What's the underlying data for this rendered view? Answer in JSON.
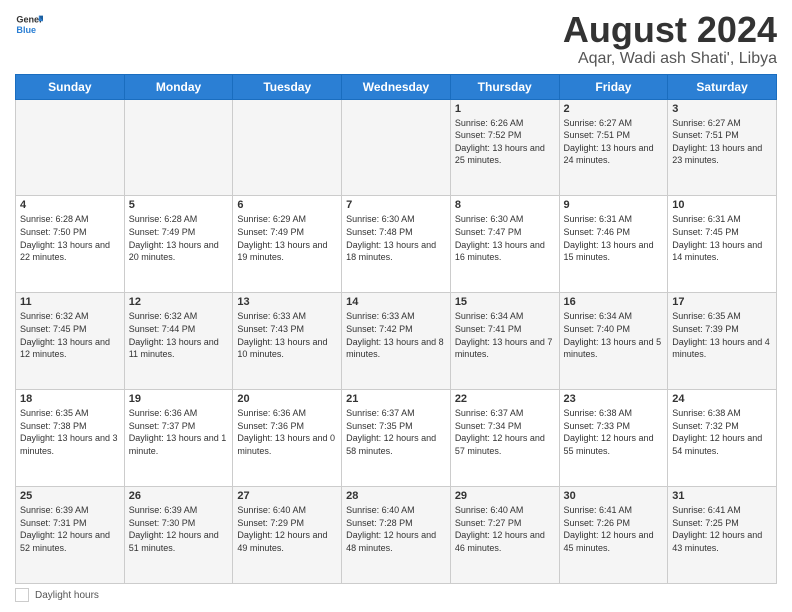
{
  "header": {
    "logo_line1": "General",
    "logo_line2": "Blue",
    "month": "August 2024",
    "location": "Aqar, Wadi ash Shati', Libya"
  },
  "weekdays": [
    "Sunday",
    "Monday",
    "Tuesday",
    "Wednesday",
    "Thursday",
    "Friday",
    "Saturday"
  ],
  "weeks": [
    [
      {
        "day": "",
        "info": ""
      },
      {
        "day": "",
        "info": ""
      },
      {
        "day": "",
        "info": ""
      },
      {
        "day": "",
        "info": ""
      },
      {
        "day": "1",
        "info": "Sunrise: 6:26 AM\nSunset: 7:52 PM\nDaylight: 13 hours\nand 25 minutes."
      },
      {
        "day": "2",
        "info": "Sunrise: 6:27 AM\nSunset: 7:51 PM\nDaylight: 13 hours\nand 24 minutes."
      },
      {
        "day": "3",
        "info": "Sunrise: 6:27 AM\nSunset: 7:51 PM\nDaylight: 13 hours\nand 23 minutes."
      }
    ],
    [
      {
        "day": "4",
        "info": "Sunrise: 6:28 AM\nSunset: 7:50 PM\nDaylight: 13 hours\nand 22 minutes."
      },
      {
        "day": "5",
        "info": "Sunrise: 6:28 AM\nSunset: 7:49 PM\nDaylight: 13 hours\nand 20 minutes."
      },
      {
        "day": "6",
        "info": "Sunrise: 6:29 AM\nSunset: 7:49 PM\nDaylight: 13 hours\nand 19 minutes."
      },
      {
        "day": "7",
        "info": "Sunrise: 6:30 AM\nSunset: 7:48 PM\nDaylight: 13 hours\nand 18 minutes."
      },
      {
        "day": "8",
        "info": "Sunrise: 6:30 AM\nSunset: 7:47 PM\nDaylight: 13 hours\nand 16 minutes."
      },
      {
        "day": "9",
        "info": "Sunrise: 6:31 AM\nSunset: 7:46 PM\nDaylight: 13 hours\nand 15 minutes."
      },
      {
        "day": "10",
        "info": "Sunrise: 6:31 AM\nSunset: 7:45 PM\nDaylight: 13 hours\nand 14 minutes."
      }
    ],
    [
      {
        "day": "11",
        "info": "Sunrise: 6:32 AM\nSunset: 7:45 PM\nDaylight: 13 hours\nand 12 minutes."
      },
      {
        "day": "12",
        "info": "Sunrise: 6:32 AM\nSunset: 7:44 PM\nDaylight: 13 hours\nand 11 minutes."
      },
      {
        "day": "13",
        "info": "Sunrise: 6:33 AM\nSunset: 7:43 PM\nDaylight: 13 hours\nand 10 minutes."
      },
      {
        "day": "14",
        "info": "Sunrise: 6:33 AM\nSunset: 7:42 PM\nDaylight: 13 hours\nand 8 minutes."
      },
      {
        "day": "15",
        "info": "Sunrise: 6:34 AM\nSunset: 7:41 PM\nDaylight: 13 hours\nand 7 minutes."
      },
      {
        "day": "16",
        "info": "Sunrise: 6:34 AM\nSunset: 7:40 PM\nDaylight: 13 hours\nand 5 minutes."
      },
      {
        "day": "17",
        "info": "Sunrise: 6:35 AM\nSunset: 7:39 PM\nDaylight: 13 hours\nand 4 minutes."
      }
    ],
    [
      {
        "day": "18",
        "info": "Sunrise: 6:35 AM\nSunset: 7:38 PM\nDaylight: 13 hours\nand 3 minutes."
      },
      {
        "day": "19",
        "info": "Sunrise: 6:36 AM\nSunset: 7:37 PM\nDaylight: 13 hours\nand 1 minute."
      },
      {
        "day": "20",
        "info": "Sunrise: 6:36 AM\nSunset: 7:36 PM\nDaylight: 13 hours\nand 0 minutes."
      },
      {
        "day": "21",
        "info": "Sunrise: 6:37 AM\nSunset: 7:35 PM\nDaylight: 12 hours\nand 58 minutes."
      },
      {
        "day": "22",
        "info": "Sunrise: 6:37 AM\nSunset: 7:34 PM\nDaylight: 12 hours\nand 57 minutes."
      },
      {
        "day": "23",
        "info": "Sunrise: 6:38 AM\nSunset: 7:33 PM\nDaylight: 12 hours\nand 55 minutes."
      },
      {
        "day": "24",
        "info": "Sunrise: 6:38 AM\nSunset: 7:32 PM\nDaylight: 12 hours\nand 54 minutes."
      }
    ],
    [
      {
        "day": "25",
        "info": "Sunrise: 6:39 AM\nSunset: 7:31 PM\nDaylight: 12 hours\nand 52 minutes."
      },
      {
        "day": "26",
        "info": "Sunrise: 6:39 AM\nSunset: 7:30 PM\nDaylight: 12 hours\nand 51 minutes."
      },
      {
        "day": "27",
        "info": "Sunrise: 6:40 AM\nSunset: 7:29 PM\nDaylight: 12 hours\nand 49 minutes."
      },
      {
        "day": "28",
        "info": "Sunrise: 6:40 AM\nSunset: 7:28 PM\nDaylight: 12 hours\nand 48 minutes."
      },
      {
        "day": "29",
        "info": "Sunrise: 6:40 AM\nSunset: 7:27 PM\nDaylight: 12 hours\nand 46 minutes."
      },
      {
        "day": "30",
        "info": "Sunrise: 6:41 AM\nSunset: 7:26 PM\nDaylight: 12 hours\nand 45 minutes."
      },
      {
        "day": "31",
        "info": "Sunrise: 6:41 AM\nSunset: 7:25 PM\nDaylight: 12 hours\nand 43 minutes."
      }
    ]
  ],
  "footer": {
    "label": "Daylight hours"
  }
}
